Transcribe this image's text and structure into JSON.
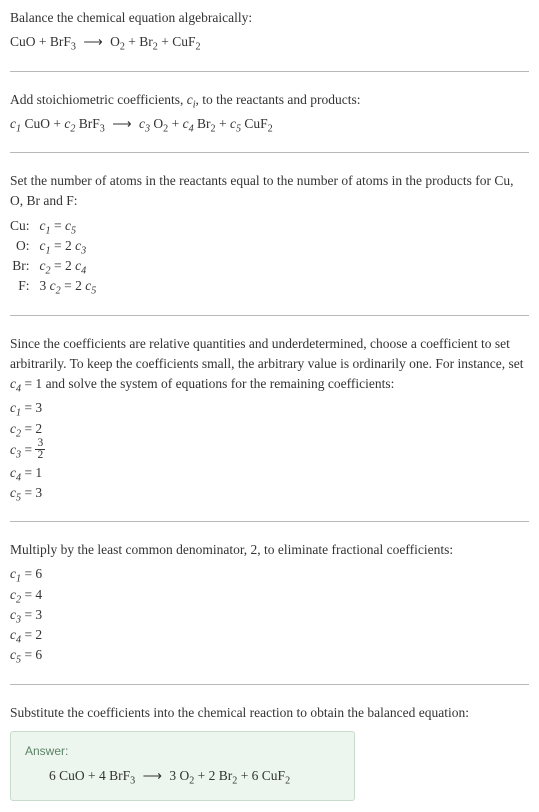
{
  "step1": {
    "text": "Balance the chemical equation algebraically:",
    "equation_lhs": "CuO + BrF",
    "equation_lhs_sub": "3",
    "arrow": "⟶",
    "equation_r1": "O",
    "equation_r1_sub": "2",
    "equation_r2": "Br",
    "equation_r2_sub": "2",
    "equation_r3": "CuF",
    "equation_r3_sub": "2"
  },
  "step2": {
    "text_a": "Add stoichiometric coefficients, ",
    "coeff_sym": "c",
    "coeff_sub": "i",
    "text_b": ", to the reactants and products:",
    "c1": "c",
    "c1sub": "1",
    "sp1": " CuO + ",
    "c2": "c",
    "c2sub": "2",
    "sp2": " BrF",
    "sp2sub": "3",
    "arrow": "⟶",
    "c3": "c",
    "c3sub": "3",
    "sp3": " O",
    "sp3sub": "2",
    "c4": "c",
    "c4sub": "4",
    "sp4": " Br",
    "sp4sub": "2",
    "c5": "c",
    "c5sub": "5",
    "sp5": " CuF",
    "sp5sub": "2"
  },
  "step3": {
    "text": "Set the number of atoms in the reactants equal to the number of atoms in the products for Cu, O, Br and F:",
    "rows": [
      {
        "label": "Cu:",
        "lhs": "c",
        "lhs_sub": "1",
        "eq": " = ",
        "rhs": "c",
        "rhs_sub": "5",
        "pre": ""
      },
      {
        "label": "O:",
        "lhs": "c",
        "lhs_sub": "1",
        "eq": " = 2 ",
        "rhs": "c",
        "rhs_sub": "3",
        "pre": ""
      },
      {
        "label": "Br:",
        "lhs": "c",
        "lhs_sub": "2",
        "eq": " = 2 ",
        "rhs": "c",
        "rhs_sub": "4",
        "pre": ""
      },
      {
        "label": "F:",
        "lhs": "c",
        "lhs_sub": "2",
        "eq": " = 2 ",
        "rhs": "c",
        "rhs_sub": "5",
        "pre": "3 "
      }
    ]
  },
  "step4": {
    "text_a": "Since the coefficients are relative quantities and underdetermined, choose a coefficient to set arbitrarily. To keep the coefficients small, the arbitrary value is ordinarily one. For instance, set ",
    "set_c": "c",
    "set_c_sub": "4",
    "set_val": " = 1",
    "text_b": " and solve the system of equations for the remaining coefficients:",
    "coeffs": [
      {
        "c": "c",
        "sub": "1",
        "val": " = 3"
      },
      {
        "c": "c",
        "sub": "2",
        "val": " = 2"
      },
      {
        "c": "c",
        "sub": "3",
        "val": " = ",
        "frac_num": "3",
        "frac_den": "2"
      },
      {
        "c": "c",
        "sub": "4",
        "val": " = 1"
      },
      {
        "c": "c",
        "sub": "5",
        "val": " = 3"
      }
    ]
  },
  "step5": {
    "text": "Multiply by the least common denominator, 2, to eliminate fractional coefficients:",
    "coeffs": [
      {
        "c": "c",
        "sub": "1",
        "val": " = 6"
      },
      {
        "c": "c",
        "sub": "2",
        "val": " = 4"
      },
      {
        "c": "c",
        "sub": "3",
        "val": " = 3"
      },
      {
        "c": "c",
        "sub": "4",
        "val": " = 2"
      },
      {
        "c": "c",
        "sub": "5",
        "val": " = 6"
      }
    ]
  },
  "step6": {
    "text": "Substitute the coefficients into the chemical reaction to obtain the balanced equation:"
  },
  "answer": {
    "label": "Answer:",
    "eq_a": "6 CuO + 4 BrF",
    "eq_a_sub": "3",
    "arrow": "⟶",
    "eq_b": "3 O",
    "eq_b_sub": "2",
    "eq_c": " + 2 Br",
    "eq_c_sub": "2",
    "eq_d": " + 6 CuF",
    "eq_d_sub": "2"
  }
}
